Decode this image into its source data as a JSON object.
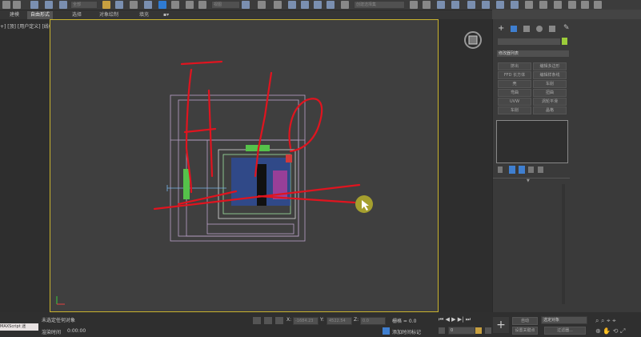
{
  "toolbar": {
    "selection_set_placeholder": "创建选择集",
    "view_label": "视图",
    "filter_label": "全部"
  },
  "ribbon": {
    "tabs": [
      "建模",
      "自由形式",
      "选择",
      "对象绘制",
      "填充"
    ],
    "active_index": 1
  },
  "viewport": {
    "label": "+] [顶] [用户定义] [线框]"
  },
  "command_panel": {
    "modifier_list": "修改器列表",
    "buttons": [
      [
        "挤出",
        "编辑多边形"
      ],
      [
        "FFD 长方体",
        "编辑样条线"
      ],
      [
        "壳",
        "车削"
      ],
      [
        "弯曲",
        "扭曲"
      ],
      [
        "UVW",
        "涡轮平滑"
      ],
      [
        "车削",
        "晶格"
      ]
    ]
  },
  "status": {
    "maxscript_label": "MAXScript 迷",
    "selection_text": "未选定任何对象",
    "render_time_label": "渲染时间",
    "render_time_value": "0:00:00",
    "x_label": "X:",
    "x_value": "-1684.23",
    "y_label": "Y:",
    "y_value": "4522.54",
    "z_label": "Z:",
    "z_value": "0.0",
    "grid_text": "栅格 = 0.0",
    "add_time_tag": "添加时间标记",
    "frame_value": "0",
    "auto_label": "自动",
    "selected_object_label": "选定对象",
    "set_key_label": "设置关键点",
    "filter_label": "过滤器..."
  },
  "colors": {
    "viewport_border": "#c9b32e",
    "annotation_red": "#e0141f",
    "cursor": "#c8c02a"
  }
}
